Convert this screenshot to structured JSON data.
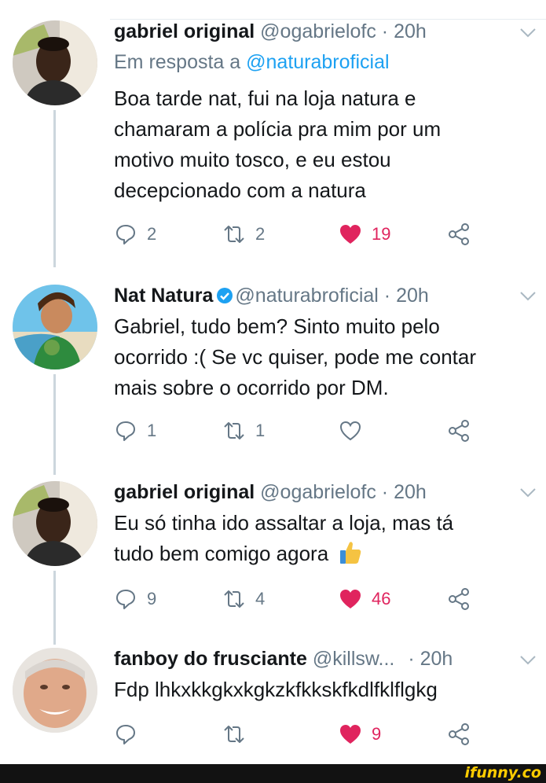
{
  "tweets": [
    {
      "name": "gabriel original",
      "handle": "@ogabrielofc",
      "time": "· 20h",
      "reply_prefix": "Em resposta a",
      "reply_mention": "@naturabroficial",
      "lines": [
        "Boa tarde nat, fui na loja natura e",
        "chamaram a polícia pra mim por um",
        "motivo muito tosco, e eu estou",
        "decepcionado com a natura"
      ],
      "replies": "2",
      "retweets": "2",
      "likes": "19",
      "liked": true
    },
    {
      "name": "Nat Natura",
      "handle": "@naturabroficial",
      "time": "· 20h",
      "verified": true,
      "lines": [
        "Gabriel, tudo bem? Sinto muito pelo",
        "ocorrido :( Se vc quiser, pode me contar",
        "mais sobre o ocorrido por DM."
      ],
      "replies": "1",
      "retweets": "1",
      "likes": "",
      "liked": false
    },
    {
      "name": "gabriel original",
      "handle": "@ogabrielofc",
      "time": "· 20h",
      "lines": [
        "Eu só tinha ido assaltar a loja, mas tá",
        "tudo bem comigo agora"
      ],
      "emoji": "thumbs-up",
      "replies": "9",
      "retweets": "4",
      "likes": "46",
      "liked": true
    },
    {
      "name": "fanboy do frusciante",
      "handle": "@killsw...",
      "time": "· 20h",
      "lines": [
        "Fdp lhkxkkgkxkgkzkfkkskfkdlfklflgkg"
      ],
      "replies": "",
      "retweets": "",
      "likes": "9",
      "liked": true
    }
  ],
  "watermark": "ifunny.co",
  "colors": {
    "like": "#e0245e",
    "muted": "#657786",
    "link": "#1da1f2",
    "verified": "#1da1f2"
  }
}
